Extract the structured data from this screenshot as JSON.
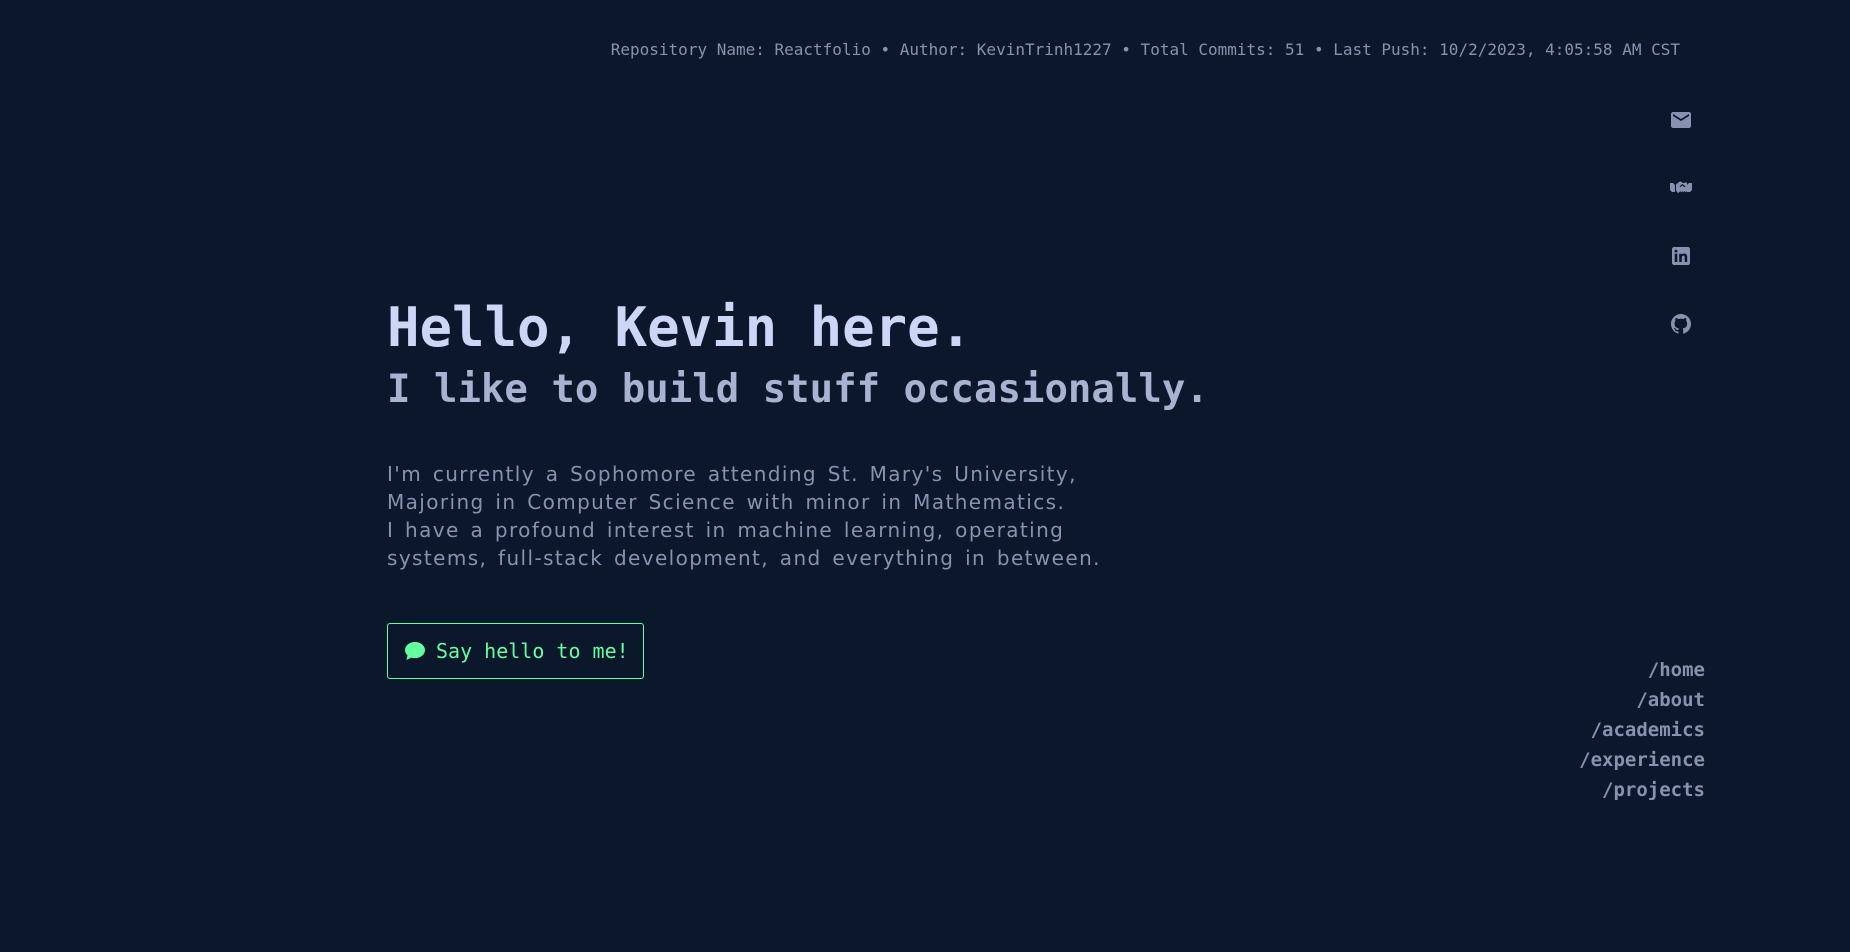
{
  "header": {
    "repo_info": "Repository Name: Reactfolio • Author: KevinTrinh1227 • Total Commits: 51 • Last Push: 10/2/2023, 4:05:58 AM CST"
  },
  "social_links": [
    {
      "icon": "mail-icon"
    },
    {
      "icon": "handshake-icon"
    },
    {
      "icon": "linkedin-icon"
    },
    {
      "icon": "github-icon"
    }
  ],
  "hero": {
    "title": "Hello, Kevin here.",
    "subtitle": "I like to build stuff occasionally.",
    "description_lines": [
      "I'm currently a Sophomore attending St. Mary's University,",
      "Majoring in Computer Science with minor in Mathematics.",
      "I have a profound interest in machine learning, operating",
      "systems, full-stack development, and everything in between."
    ]
  },
  "cta": {
    "label": "Say hello to me!",
    "icon": "chat-bubble-icon"
  },
  "nav": {
    "items": [
      "/home",
      "/about",
      "/academics",
      "/experience",
      "/projects"
    ]
  },
  "colors": {
    "background": "#0b172a",
    "heading": "#ccd6f6",
    "text": "#8892b0",
    "accent": "#64ffa0"
  }
}
